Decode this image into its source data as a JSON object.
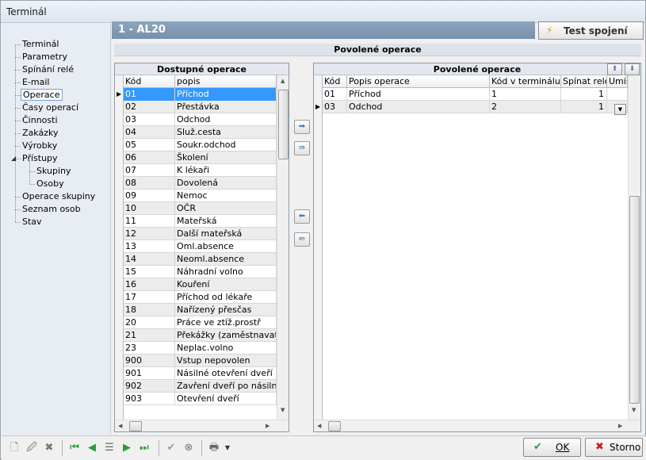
{
  "window": {
    "title": "Terminál"
  },
  "tree": {
    "items": [
      {
        "label": "Terminál",
        "level": 0
      },
      {
        "label": "Parametry",
        "level": 0
      },
      {
        "label": "Spínání relé",
        "level": 0
      },
      {
        "label": "E-mail",
        "level": 0
      },
      {
        "label": "Operace",
        "level": 0,
        "selected": true
      },
      {
        "label": "Časy operací",
        "level": 0
      },
      {
        "label": "Činnosti",
        "level": 0
      },
      {
        "label": "Zakázky",
        "level": 0
      },
      {
        "label": "Výrobky",
        "level": 0
      },
      {
        "label": "Přístupy",
        "level": 0,
        "expanded": true
      },
      {
        "label": "Skupiny",
        "level": 1
      },
      {
        "label": "Osoby",
        "level": 1
      },
      {
        "label": "Operace skupiny",
        "level": 0
      },
      {
        "label": "Seznam osob",
        "level": 0
      },
      {
        "label": "Stav",
        "level": 0
      }
    ]
  },
  "header": {
    "title": "1  -  AL20"
  },
  "test_button": {
    "label": "Test spojení"
  },
  "section_title": "Povolené operace",
  "available": {
    "caption": "Dostupné operace",
    "columns": [
      "Kód",
      "popis"
    ],
    "rows": [
      [
        "01",
        "Příchod"
      ],
      [
        "02",
        "Přestávka"
      ],
      [
        "03",
        "Odchod"
      ],
      [
        "04",
        "Služ.cesta"
      ],
      [
        "05",
        "Soukr.odchod"
      ],
      [
        "06",
        "Školení"
      ],
      [
        "07",
        "K lékaři"
      ],
      [
        "08",
        "Dovolená"
      ],
      [
        "09",
        "Nemoc"
      ],
      [
        "10",
        "OČR"
      ],
      [
        "11",
        "Mateřská"
      ],
      [
        "12",
        "Další mateřská"
      ],
      [
        "13",
        "Oml.absence"
      ],
      [
        "14",
        "Neoml.absence"
      ],
      [
        "15",
        "Náhradní volno"
      ],
      [
        "16",
        "Kouření"
      ],
      [
        "17",
        "Příchod od lékaře"
      ],
      [
        "18",
        "Nařízený přesčas"
      ],
      [
        "20",
        "Práce ve ztíž.prostř"
      ],
      [
        "21",
        "Překážky (zaměstnavatel)"
      ],
      [
        "23",
        "Neplac.volno"
      ],
      [
        "900",
        "Vstup nepovolen"
      ],
      [
        "901",
        "Násilné otevření dveří"
      ],
      [
        "902",
        "Zavření dveří po násilném"
      ],
      [
        "903",
        "Otevření dveří"
      ]
    ]
  },
  "allowed": {
    "caption": "Povolené operace",
    "columns": [
      "Kód",
      "Popis operace",
      "Kód v terminálu",
      "Spínat relé",
      "Umís"
    ],
    "rows": [
      [
        "01",
        "Příchod",
        "1",
        "1"
      ],
      [
        "03",
        "Odchod",
        "2",
        "1"
      ]
    ]
  },
  "buttons": {
    "ok": "OK",
    "cancel": "Storno"
  }
}
